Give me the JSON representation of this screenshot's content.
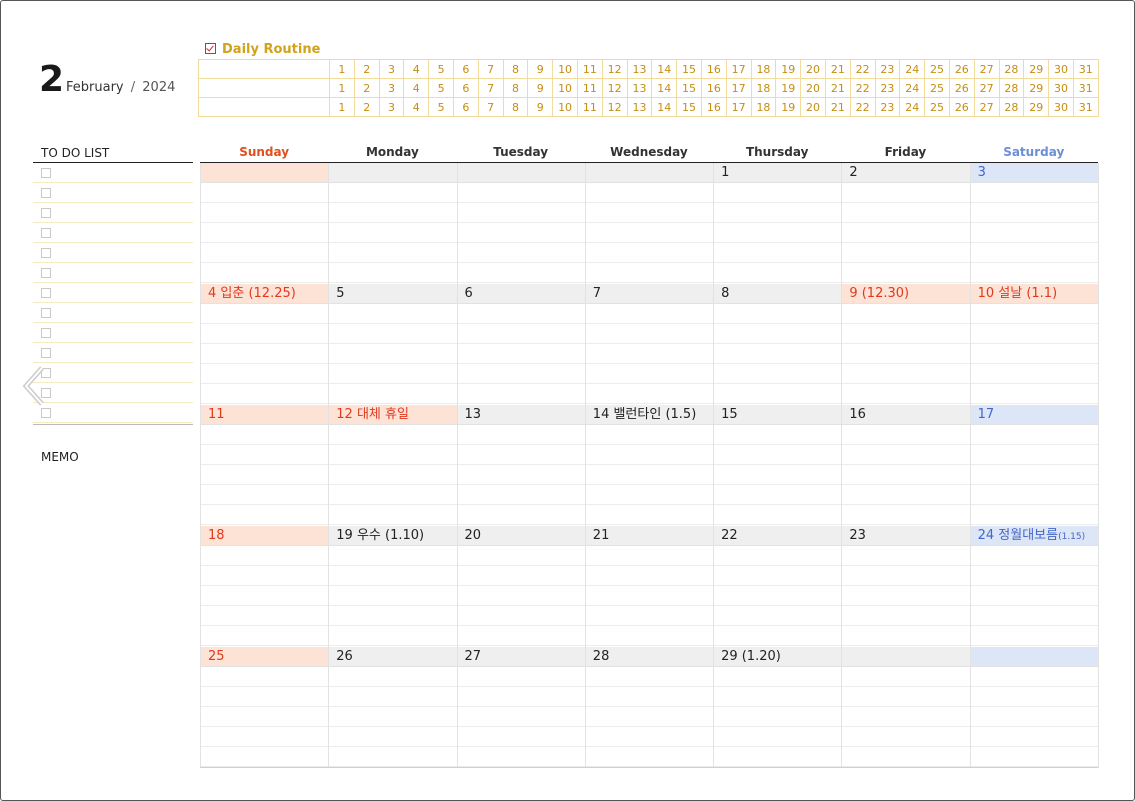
{
  "header": {
    "month_number": "2",
    "month_name": "February",
    "separator": "/",
    "year": "2024"
  },
  "routine": {
    "title": "Daily Routine",
    "rows": 3,
    "days": [
      "1",
      "2",
      "3",
      "4",
      "5",
      "6",
      "7",
      "8",
      "9",
      "10",
      "11",
      "12",
      "13",
      "14",
      "15",
      "16",
      "17",
      "18",
      "19",
      "20",
      "21",
      "22",
      "23",
      "24",
      "25",
      "26",
      "27",
      "28",
      "29",
      "30",
      "31"
    ]
  },
  "todo": {
    "title": "TO DO LIST",
    "count": 13
  },
  "memo": {
    "title": "MEMO"
  },
  "calendar": {
    "day_names": [
      "Sunday",
      "Monday",
      "Tuesday",
      "Wednesday",
      "Thursday",
      "Friday",
      "Saturday"
    ],
    "weeks": [
      [
        {
          "label": ""
        },
        {
          "label": ""
        },
        {
          "label": ""
        },
        {
          "label": ""
        },
        {
          "label": "1"
        },
        {
          "label": "2"
        },
        {
          "label": "3"
        }
      ],
      [
        {
          "label": "4 입춘 (12.25)"
        },
        {
          "label": "5"
        },
        {
          "label": "6"
        },
        {
          "label": "7"
        },
        {
          "label": "8"
        },
        {
          "label": "9 (12.30)",
          "holiday": true
        },
        {
          "label": "10 설날 (1.1)",
          "holiday": true
        }
      ],
      [
        {
          "label": "11"
        },
        {
          "label": "12 대체 휴일",
          "holiday": true
        },
        {
          "label": "13"
        },
        {
          "label": "14 밸런타인 (1.5)"
        },
        {
          "label": "15"
        },
        {
          "label": "16"
        },
        {
          "label": "17"
        }
      ],
      [
        {
          "label": "18"
        },
        {
          "label": "19 우수 (1.10)"
        },
        {
          "label": "20"
        },
        {
          "label": "21"
        },
        {
          "label": "22"
        },
        {
          "label": "23"
        },
        {
          "label": "24 정월대보름",
          "small": "(1.15)"
        }
      ],
      [
        {
          "label": "25"
        },
        {
          "label": "26"
        },
        {
          "label": "27"
        },
        {
          "label": "28"
        },
        {
          "label": "29 (1.20)"
        },
        {
          "label": ""
        },
        {
          "label": ""
        }
      ]
    ]
  },
  "colors": {
    "sunday": "#e0501e",
    "saturday": "#6b8ed6",
    "routine": "#c58e12",
    "holiday": "#e03a1e"
  }
}
